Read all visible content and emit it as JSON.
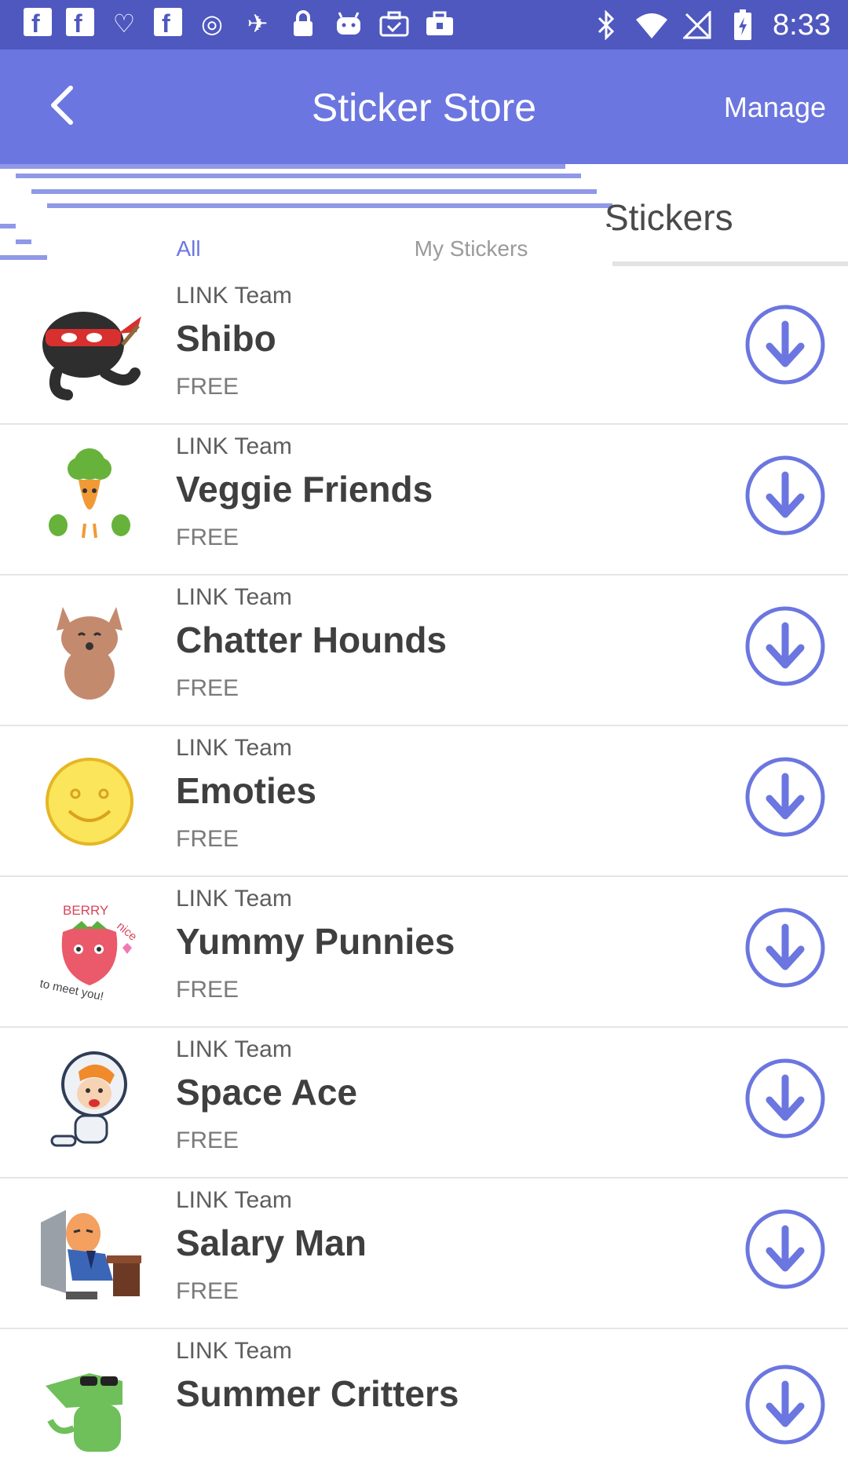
{
  "status_bar": {
    "time": "8:33",
    "left_icons": [
      "facebook-icon",
      "facebook-icon",
      "iheart-icon",
      "facebook-icon",
      "circle-icon",
      "fake-gps-icon",
      "lock-icon",
      "android-icon",
      "briefcase-check-icon",
      "briefcase-icon"
    ],
    "right_icons": [
      "bluetooth-icon",
      "wifi-icon",
      "no-signal-icon",
      "battery-charging-icon"
    ]
  },
  "header": {
    "title": "Sticker Store",
    "manage_label": "Manage",
    "back_icon": "chevron-left-icon"
  },
  "tabs": [
    {
      "label": "All",
      "active": true
    },
    {
      "label": "My Stickers",
      "active": false
    }
  ],
  "background_tab_label": "Stickers",
  "colors": {
    "status_bar": "#4f58bf",
    "app_bar": "#6b76e0",
    "accent": "#6b76e0"
  },
  "stickers": [
    {
      "author": "LINK Team",
      "name": "Shibo",
      "price": "FREE",
      "thumb": "ninja-sticker"
    },
    {
      "author": "LINK Team",
      "name": "Veggie Friends",
      "price": "FREE",
      "thumb": "veggie-sticker"
    },
    {
      "author": "LINK Team",
      "name": "Chatter Hounds",
      "price": "FREE",
      "thumb": "hound-sticker"
    },
    {
      "author": "LINK Team",
      "name": "Emoties",
      "price": "FREE",
      "thumb": "smiley-sticker"
    },
    {
      "author": "LINK Team",
      "name": "Yummy Punnies",
      "price": "FREE",
      "thumb": "strawberry-sticker",
      "thumb_text": [
        "BERRY",
        "nice",
        "to meet you!"
      ]
    },
    {
      "author": "LINK Team",
      "name": "Space Ace",
      "price": "FREE",
      "thumb": "astronaut-sticker"
    },
    {
      "author": "LINK Team",
      "name": "Salary Man",
      "price": "FREE",
      "thumb": "office-man-sticker"
    },
    {
      "author": "LINK Team",
      "name": "Summer Critters",
      "price": "",
      "thumb": "crocodile-sticker"
    }
  ]
}
